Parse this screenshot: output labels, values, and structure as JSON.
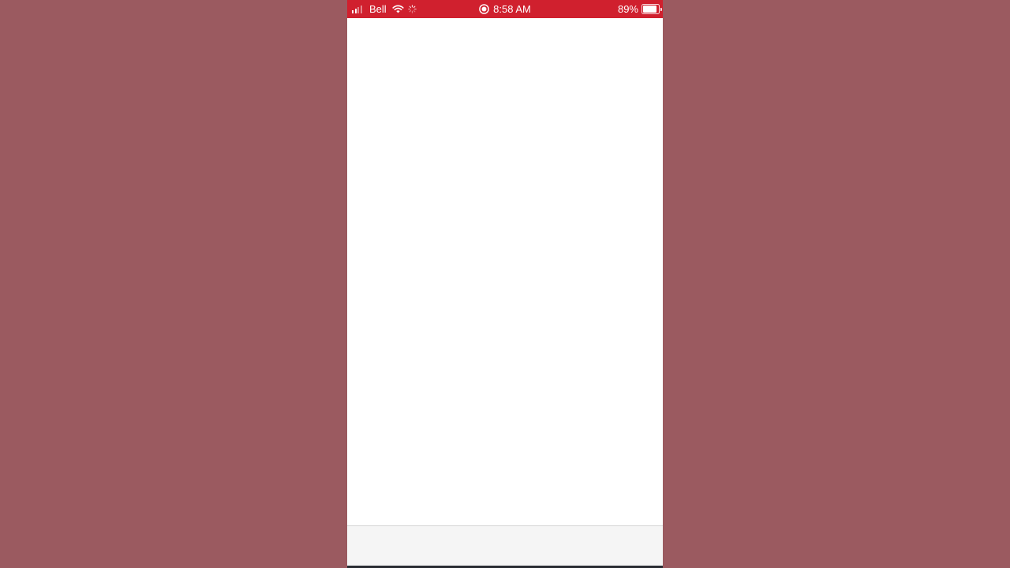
{
  "status_bar": {
    "carrier": "Bell",
    "time": "8:58 AM",
    "battery_percent": "89%",
    "battery_level": 0.89,
    "background_color": "#d0202e",
    "icons": {
      "signal": "cellular-signal-icon",
      "wifi": "wifi-icon",
      "activity": "network-activity-icon",
      "recording": "screen-recording-icon",
      "battery": "battery-icon"
    }
  },
  "colors": {
    "backdrop": "#9b5a60",
    "content_background": "#ffffff",
    "bottom_bar_background": "#f5f5f5"
  }
}
